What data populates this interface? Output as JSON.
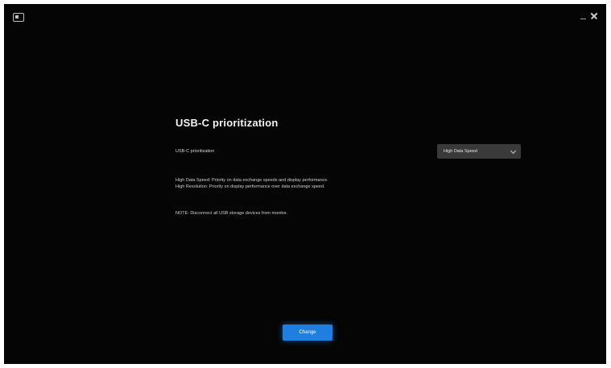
{
  "header": {
    "app_icon": "monitor-icon",
    "close_icon": "close-icon",
    "minimize_icon": "minimize-icon"
  },
  "main": {
    "title": "USB-C prioritization",
    "setting_label": "USB-C prioritization",
    "dropdown_value": "High Data Speed",
    "descriptions": [
      "High Data Speed: Priority on data exchange speeds and display performance.",
      "High Resolution: Priority on display performance over data exchange speed."
    ],
    "note": "NOTE: Disconnect all USB storage devices from monitor."
  },
  "footer": {
    "primary_button_label": "Change"
  },
  "colors": {
    "background": "#050505",
    "accent": "#1e7fe0",
    "dropdown_bg": "#3a3a3a"
  }
}
